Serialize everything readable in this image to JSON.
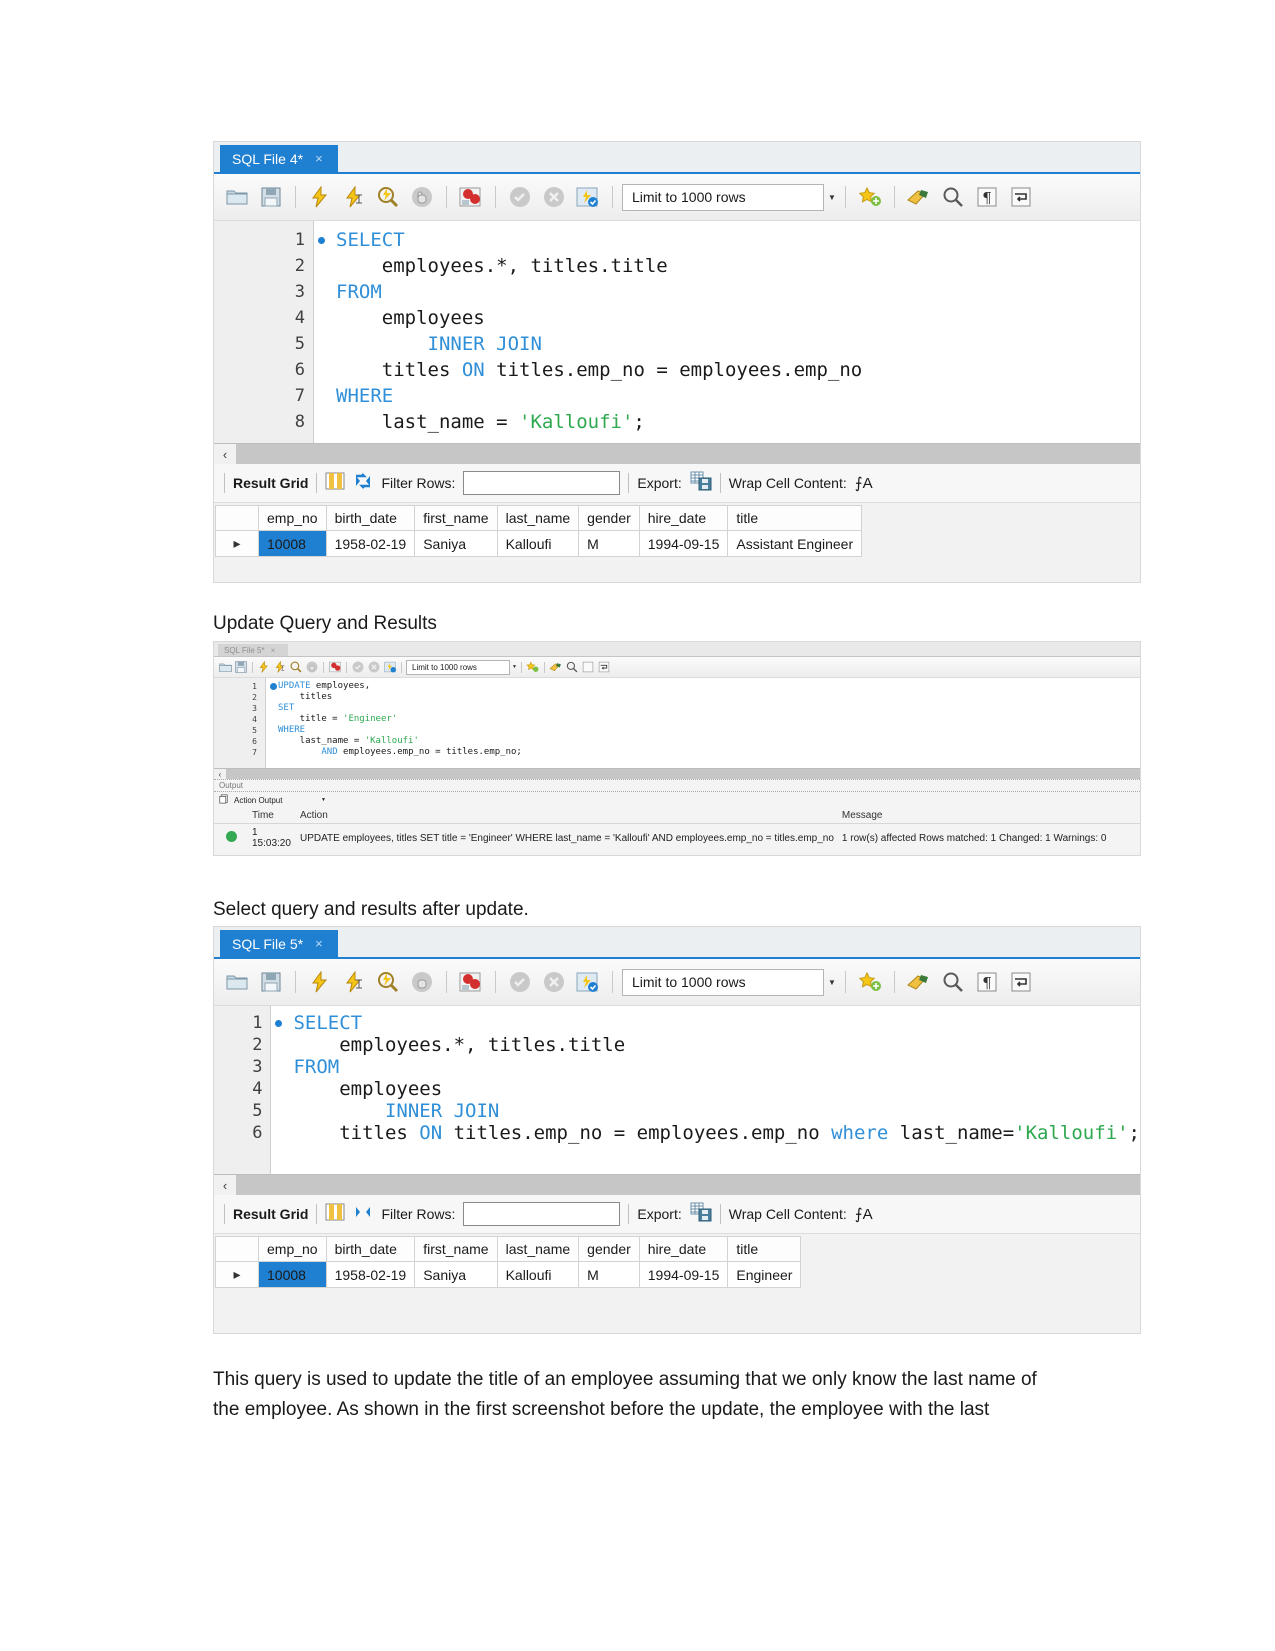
{
  "shot1": {
    "tab": {
      "label": "SQL File 4*",
      "close": "×"
    },
    "toolbar": {
      "limit_value": "Limit to 1000 rows",
      "icons": [
        "open-folder-icon",
        "save-icon",
        "execute-icon",
        "execute-current-icon",
        "explain-icon",
        "stop-icon",
        "toggle-breakpoint-icon",
        "commit-icon",
        "rollback-icon",
        "auto-commit-icon",
        "beautify-icon",
        "find-icon",
        "invisible-chars-icon",
        "wrap-lines-icon"
      ]
    },
    "code_lines": [
      {
        "n": "1",
        "marker": true,
        "tokens": [
          {
            "t": "SELECT",
            "c": "kw"
          }
        ]
      },
      {
        "n": "2",
        "marker": false,
        "tokens": [
          {
            "t": "    employees.*, titles.title",
            "c": "plain"
          }
        ]
      },
      {
        "n": "3",
        "marker": false,
        "tokens": [
          {
            "t": "FROM",
            "c": "kw"
          }
        ]
      },
      {
        "n": "4",
        "marker": false,
        "tokens": [
          {
            "t": "    employees",
            "c": "plain"
          }
        ]
      },
      {
        "n": "5",
        "marker": false,
        "tokens": [
          {
            "t": "        ",
            "c": "plain"
          },
          {
            "t": "INNER JOIN",
            "c": "kw"
          }
        ]
      },
      {
        "n": "6",
        "marker": false,
        "tokens": [
          {
            "t": "    titles ",
            "c": "plain"
          },
          {
            "t": "ON",
            "c": "kw"
          },
          {
            "t": " titles.emp_no = employees.emp_no",
            "c": "plain"
          }
        ]
      },
      {
        "n": "7",
        "marker": false,
        "tokens": [
          {
            "t": "WHERE",
            "c": "kw"
          }
        ]
      },
      {
        "n": "8",
        "marker": false,
        "tokens": [
          {
            "t": "    last_name = ",
            "c": "plain"
          },
          {
            "t": "'Kalloufi'",
            "c": "str"
          },
          {
            "t": ";",
            "c": "plain"
          }
        ]
      }
    ],
    "result_bar": {
      "result_grid_label": "Result Grid",
      "filter_label": "Filter Rows:",
      "filter_value": "",
      "export_label": "Export:",
      "wrap_label": "Wrap Cell Content:",
      "wrap_glyph": "⨍A"
    },
    "grid": {
      "columns": [
        "emp_no",
        "birth_date",
        "first_name",
        "last_name",
        "gender",
        "hire_date",
        "title"
      ],
      "rows": [
        {
          "selected_index": 0,
          "cells": [
            "10008",
            "1958-02-19",
            "Saniya",
            "Kalloufi",
            "M",
            "1994-09-15",
            "Assistant Engineer"
          ]
        }
      ]
    }
  },
  "caption1": "Update Query and Results",
  "shot2": {
    "tab": {
      "label": "SQL File 5*",
      "close": "×"
    },
    "toolbar": {
      "limit_value": "Limit to 1000 rows"
    },
    "code_lines": [
      {
        "n": "1",
        "marker": true,
        "tokens": [
          {
            "t": "UPDATE",
            "c": "kw"
          },
          {
            "t": " employees,",
            "c": "plain"
          }
        ]
      },
      {
        "n": "2",
        "marker": false,
        "tokens": [
          {
            "t": "    titles",
            "c": "plain"
          }
        ]
      },
      {
        "n": "3",
        "marker": false,
        "tokens": [
          {
            "t": "SET",
            "c": "kw"
          }
        ]
      },
      {
        "n": "4",
        "marker": false,
        "tokens": [
          {
            "t": "    title = ",
            "c": "plain"
          },
          {
            "t": "'Engineer'",
            "c": "str"
          }
        ]
      },
      {
        "n": "5",
        "marker": false,
        "tokens": [
          {
            "t": "WHERE",
            "c": "kw"
          }
        ]
      },
      {
        "n": "6",
        "marker": false,
        "tokens": [
          {
            "t": "    last_name = ",
            "c": "plain"
          },
          {
            "t": "'Kalloufi'",
            "c": "str"
          }
        ]
      },
      {
        "n": "7",
        "marker": false,
        "tokens": [
          {
            "t": "        ",
            "c": "plain"
          },
          {
            "t": "AND",
            "c": "kw"
          },
          {
            "t": " employees.emp_no = titles.emp_no;",
            "c": "plain"
          }
        ]
      }
    ],
    "output": {
      "panel_title": "Output",
      "selector_value": "Action Output",
      "columns": [
        "",
        "Time",
        "Action",
        "Message"
      ],
      "rows": [
        {
          "status": "success",
          "num": "1",
          "time": "15:03:20",
          "action": "UPDATE employees, titles SET title = 'Engineer' WHERE last_name = 'Kalloufi' AND employees.emp_no = titles.emp_no",
          "message": "1 row(s) affected Rows matched: 1  Changed: 1  Warnings: 0"
        }
      ]
    }
  },
  "caption2": "Select query and results after update.",
  "shot3": {
    "tab": {
      "label": "SQL File 5*",
      "close": "×"
    },
    "toolbar": {
      "limit_value": "Limit to 1000 rows"
    },
    "code_lines": [
      {
        "n": "1",
        "marker": true,
        "tokens": [
          {
            "t": "SELECT",
            "c": "kw"
          }
        ]
      },
      {
        "n": "2",
        "marker": false,
        "tokens": [
          {
            "t": "    employees.*, titles.title",
            "c": "plain"
          }
        ]
      },
      {
        "n": "3",
        "marker": false,
        "tokens": [
          {
            "t": "FROM",
            "c": "kw"
          }
        ]
      },
      {
        "n": "4",
        "marker": false,
        "tokens": [
          {
            "t": "    employees",
            "c": "plain"
          }
        ]
      },
      {
        "n": "5",
        "marker": false,
        "tokens": [
          {
            "t": "        ",
            "c": "plain"
          },
          {
            "t": "INNER JOIN",
            "c": "kw"
          }
        ]
      },
      {
        "n": "6",
        "marker": false,
        "tokens": [
          {
            "t": "    titles ",
            "c": "plain"
          },
          {
            "t": "ON",
            "c": "kw"
          },
          {
            "t": " titles.emp_no = employees.emp_no ",
            "c": "plain"
          },
          {
            "t": "where",
            "c": "kw"
          },
          {
            "t": " last_name=",
            "c": "plain"
          },
          {
            "t": "'Kalloufi'",
            "c": "str"
          },
          {
            "t": ";",
            "c": "plain"
          }
        ]
      }
    ],
    "result_bar": {
      "result_grid_label": "Result Grid",
      "filter_label": "Filter Rows:",
      "filter_value": "",
      "export_label": "Export:",
      "wrap_label": "Wrap Cell Content:",
      "wrap_glyph": "⨍A"
    },
    "grid": {
      "columns": [
        "emp_no",
        "birth_date",
        "first_name",
        "last_name",
        "gender",
        "hire_date",
        "title"
      ],
      "rows": [
        {
          "selected_index": 0,
          "cells": [
            "10008",
            "1958-02-19",
            "Saniya",
            "Kalloufi",
            "M",
            "1994-09-15",
            "Engineer"
          ]
        }
      ]
    }
  },
  "paragraph": "This query is used to update the title of an employee assuming that we only know the last name of the employee. As shown in the first screenshot before the update, the employee with the last",
  "colors": {
    "accent": "#1f7fd0",
    "keyword": "#2f8fd8",
    "string": "#2ea84f",
    "selection": "#1f7fd0",
    "success": "#34a853"
  }
}
